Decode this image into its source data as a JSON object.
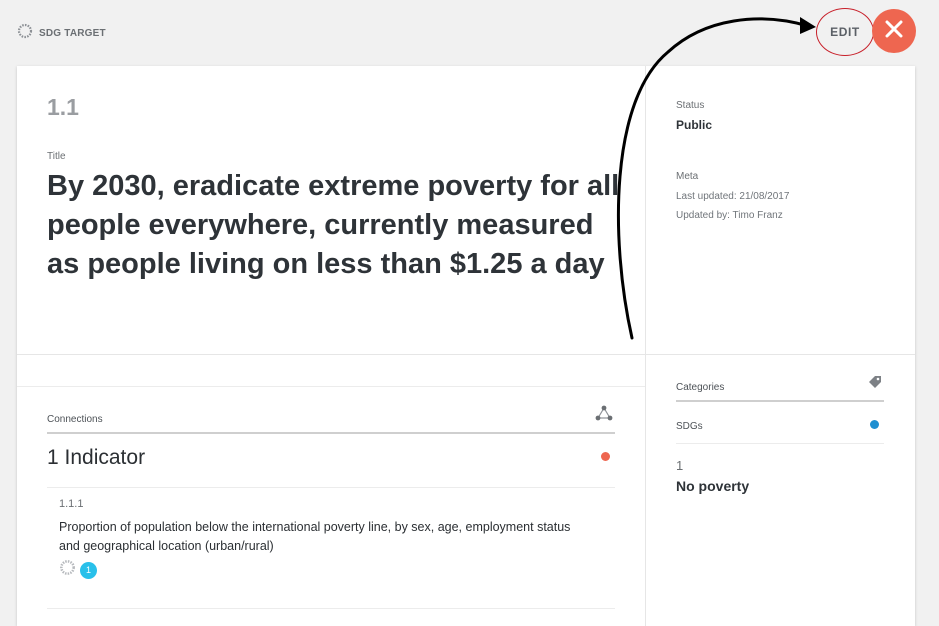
{
  "header": {
    "brand_label": "SDG TARGET",
    "edit_label": "EDIT",
    "close_icon": "close-icon"
  },
  "target": {
    "code": "1.1",
    "title_label": "Title",
    "title": "By 2030, eradicate extreme poverty for all people everywhere, currently measured as people living on less than $1.25 a day"
  },
  "sidebar": {
    "status_label": "Status",
    "status_value": "Public",
    "meta_label": "Meta",
    "last_updated": "Last updated: 21/08/2017",
    "updated_by": "Updated by: Timo Franz"
  },
  "connections": {
    "label": "Connections",
    "heading": "1 Indicator",
    "indicators": [
      {
        "code": "1.1.1",
        "description": "Proportion of population below the international poverty line, by sex, age, employment status and geographical location (urban/rural)",
        "badge": "1"
      }
    ]
  },
  "categories": {
    "label": "Categories",
    "group_label": "SDGs",
    "items": [
      {
        "number": "1",
        "name": "No poverty"
      }
    ]
  },
  "colors": {
    "accent_orange": "#ee6650",
    "sdg_blue": "#1f8fd1",
    "badge_cyan": "#29c0ea",
    "annotation_red": "#c8202a"
  }
}
